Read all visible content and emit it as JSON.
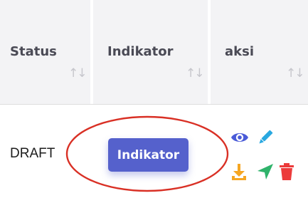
{
  "table": {
    "columns": [
      {
        "label": "Status",
        "sort_icon": "sort-arrows-icon"
      },
      {
        "label": "Indikator",
        "sort_icon": "sort-arrows-icon"
      },
      {
        "label": "aksi",
        "sort_icon": "sort-arrows-icon"
      }
    ],
    "rows": [
      {
        "status": "DRAFT",
        "indikator_button": "Indikator",
        "actions": [
          "eye-icon",
          "pencil-icon",
          "download-icon",
          "send-icon",
          "trash-icon"
        ]
      }
    ],
    "sort_icon_glyph": "↑↓"
  },
  "colors": {
    "button": "#5561cc",
    "annotation": "#d93025",
    "eye": "#4a5bd8",
    "pencil": "#29a8e0",
    "download": "#f5a623",
    "send": "#2fb36b",
    "trash": "#ec3b3b"
  }
}
